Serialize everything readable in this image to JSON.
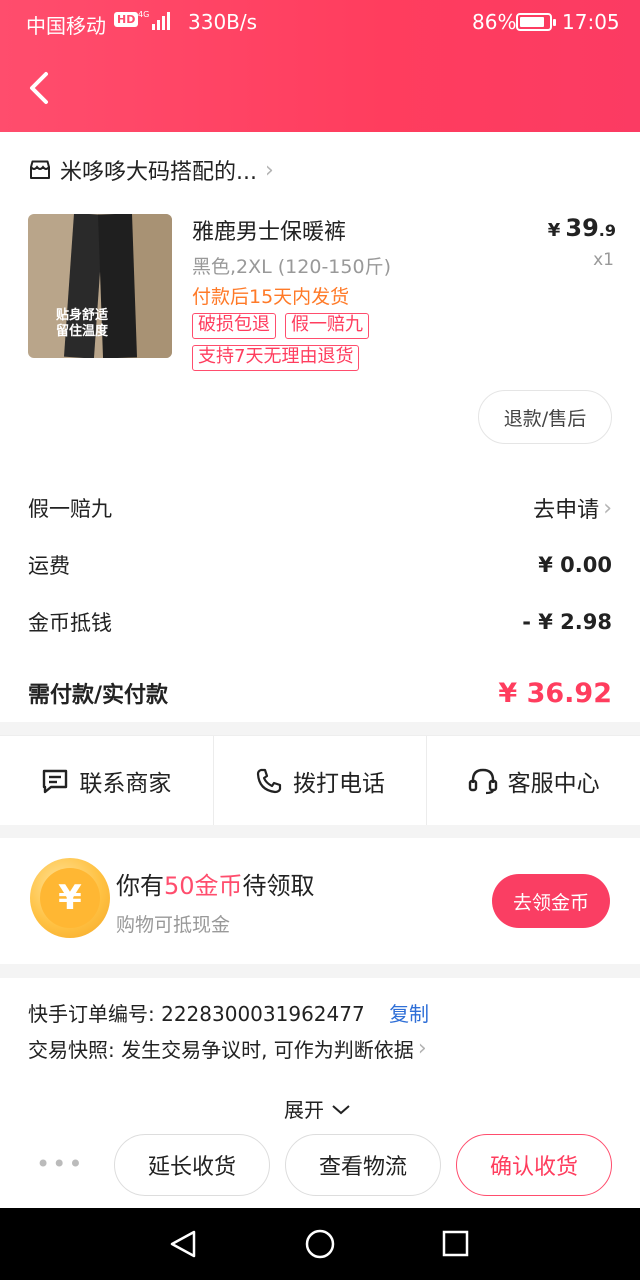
{
  "status_bar": {
    "carrier": "中国移动",
    "hd": "HD",
    "network": "4G",
    "speed": "330B/s",
    "battery": "86%",
    "battery_level": 0.86,
    "time": "17:05"
  },
  "header": {
    "back_icon": "chevron-left-icon",
    "color": "#ff4d6d"
  },
  "shop": {
    "name": "米哆哆大码搭配的..."
  },
  "product": {
    "title": "雅鹿男士保暖裤",
    "spec": "黑色,2XL (120-150斤)",
    "shipping_note": "付款后15天内发货",
    "tags": [
      "破损包退",
      "假一赔九",
      "支持7天无理由退货"
    ],
    "price_symbol": "¥",
    "price_int": "39",
    "price_dec": ".9",
    "qty": "x1",
    "thumb_text_1": "贴身舒适",
    "thumb_text_2": "留住温度",
    "refund_label": "退款/售后"
  },
  "summary": {
    "fake_label": "假一赔九",
    "fake_action": "去申请",
    "freight_label": "运费",
    "freight_value": "¥ 0.00",
    "coin_label": "金币抵钱",
    "coin_value": "- ¥ 2.98",
    "total_label": "需付款/实付款",
    "total_value": "¥ 36.92"
  },
  "actions": {
    "contact": "联系商家",
    "call": "拨打电话",
    "service": "客服中心"
  },
  "coins": {
    "title_prefix": "你有",
    "title_highlight": "50金币",
    "title_suffix": "待领取",
    "subtitle": "购物可抵现金",
    "button": "去领金币",
    "coin_symbol": "¥"
  },
  "order": {
    "number_label": "快手订单编号:",
    "number": "2228300031962477",
    "copy": "复制",
    "snapshot": "交易快照: 发生交易争议时, 可作为判断依据",
    "expand": "展开"
  },
  "bottom_buttons": {
    "more": "•••",
    "extend": "延长收货",
    "logistics": "查看物流",
    "confirm": "确认收货"
  },
  "colors": {
    "accent": "#ff3d5e",
    "link": "#2f6fd7",
    "shipping": "#ff7a28"
  }
}
